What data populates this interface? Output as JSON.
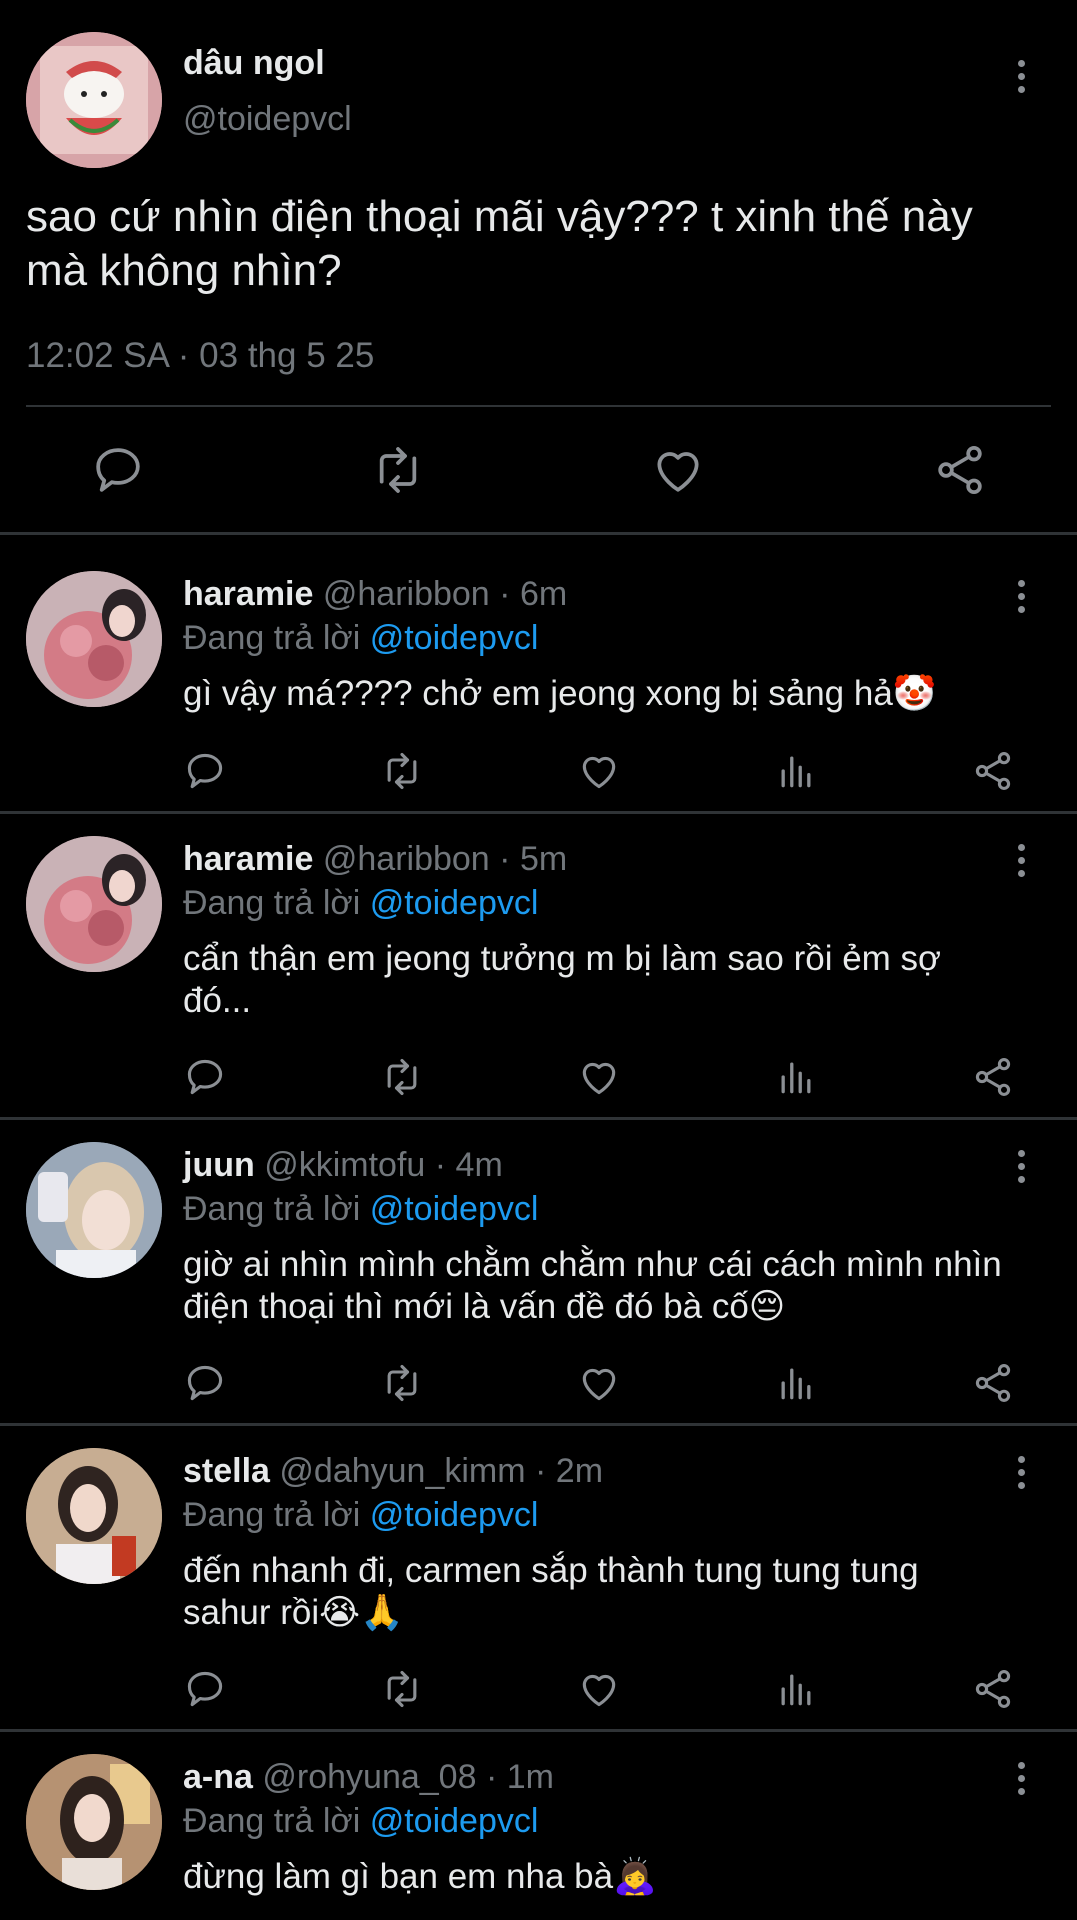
{
  "main_post": {
    "display_name": "dâu ngol",
    "handle": "@toidepvcl",
    "text": "sao cứ nhìn điện thoại mãi vậy??? t xinh thế này mà không nhìn?",
    "timestamp": "12:02 SA · 03 thg 5 25"
  },
  "replying_label": "Đang trả lời",
  "replies": [
    {
      "name": "haramie",
      "handle": "@haribbon",
      "time": "6m",
      "mention": "@toidepvcl",
      "text": "gì vậy má???? chở em jeong xong bị sảng hả🤡"
    },
    {
      "name": "haramie",
      "handle": "@haribbon",
      "time": "5m",
      "mention": "@toidepvcl",
      "text": "cẩn thận em jeong tưởng m bị làm sao rồi ẻm sợ đó..."
    },
    {
      "name": "juun",
      "handle": "@kkimtofu",
      "time": "4m",
      "mention": "@toidepvcl",
      "text": "giờ ai nhìn mình chằm chằm như cái cách mình nhìn điện thoại thì mới là vấn đề đó bà cố😔"
    },
    {
      "name": "stella",
      "handle": "@dahyun_kimm",
      "time": "2m",
      "mention": "@toidepvcl",
      "text": "đến nhanh đi, carmen sắp thành tung tung tung sahur rồi😭🙏"
    },
    {
      "name": "a-na",
      "handle": "@rohyuna_08",
      "time": "1m",
      "mention": "@toidepvcl",
      "text": "đừng làm gì bạn em nha bà🙇‍♀️"
    }
  ],
  "icons": {
    "reply": "comment-bubble-icon",
    "retweet": "repost-icon",
    "like": "heart-icon",
    "views": "bar-chart-icon",
    "share": "share-icon",
    "more": "vertical-dots-icon"
  },
  "colors": {
    "background": "#000000",
    "text": "#e7e9ea",
    "secondary": "#71767b",
    "mention": "#1d9bf0",
    "divider": "#2f3336"
  }
}
